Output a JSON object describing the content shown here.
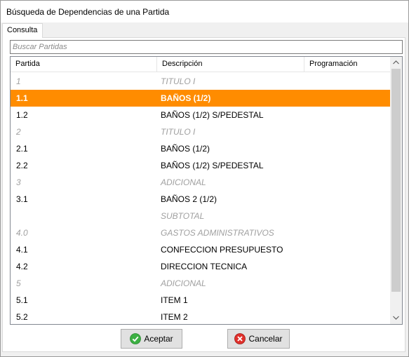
{
  "window": {
    "title": "Búsqueda de Dependencias de una Partida"
  },
  "tab": {
    "label": "Consulta"
  },
  "search": {
    "placeholder": "Buscar Partidas",
    "value": ""
  },
  "grid": {
    "columns": [
      "Partida",
      "Descripción",
      "Programación"
    ],
    "rows": [
      {
        "partida": "1",
        "descripcion": "TITULO I",
        "programacion": "",
        "type": "heading"
      },
      {
        "partida": "1.1",
        "descripcion": "BAÑOS (1/2)",
        "programacion": "",
        "type": "selected"
      },
      {
        "partida": "1.2",
        "descripcion": "BAÑOS (1/2) S/PEDESTAL",
        "programacion": "",
        "type": "item"
      },
      {
        "partida": "2",
        "descripcion": "TITULO I",
        "programacion": "",
        "type": "heading"
      },
      {
        "partida": "2.1",
        "descripcion": "BAÑOS (1/2)",
        "programacion": "",
        "type": "item"
      },
      {
        "partida": "2.2",
        "descripcion": "BAÑOS (1/2) S/PEDESTAL",
        "programacion": "",
        "type": "item"
      },
      {
        "partida": "3",
        "descripcion": "ADICIONAL",
        "programacion": "",
        "type": "heading"
      },
      {
        "partida": "3.1",
        "descripcion": "BAÑOS 2 (1/2)",
        "programacion": "",
        "type": "item"
      },
      {
        "partida": "",
        "descripcion": "SUBTOTAL",
        "programacion": "",
        "type": "heading"
      },
      {
        "partida": "4.0",
        "descripcion": "GASTOS ADMINISTRATIVOS",
        "programacion": "",
        "type": "heading"
      },
      {
        "partida": "4.1",
        "descripcion": "CONFECCION PRESUPUESTO",
        "programacion": "",
        "type": "item"
      },
      {
        "partida": "4.2",
        "descripcion": "DIRECCION TECNICA",
        "programacion": "",
        "type": "item"
      },
      {
        "partida": "5",
        "descripcion": "ADICIONAL",
        "programacion": "",
        "type": "heading"
      },
      {
        "partida": "5.1",
        "descripcion": " ITEM 1",
        "programacion": "",
        "type": "item"
      },
      {
        "partida": "5.2",
        "descripcion": " ITEM 2",
        "programacion": "",
        "type": "item"
      }
    ]
  },
  "buttons": {
    "ok_label": "Aceptar",
    "cancel_label": "Cancelar"
  },
  "icons": {
    "ok": "green-check-icon",
    "cancel": "red-x-icon"
  },
  "colors": {
    "selection": "#ff8c00",
    "heading_text": "#a0a0a0",
    "ok_icon": "#3cb043",
    "cancel_icon": "#e0302b"
  }
}
